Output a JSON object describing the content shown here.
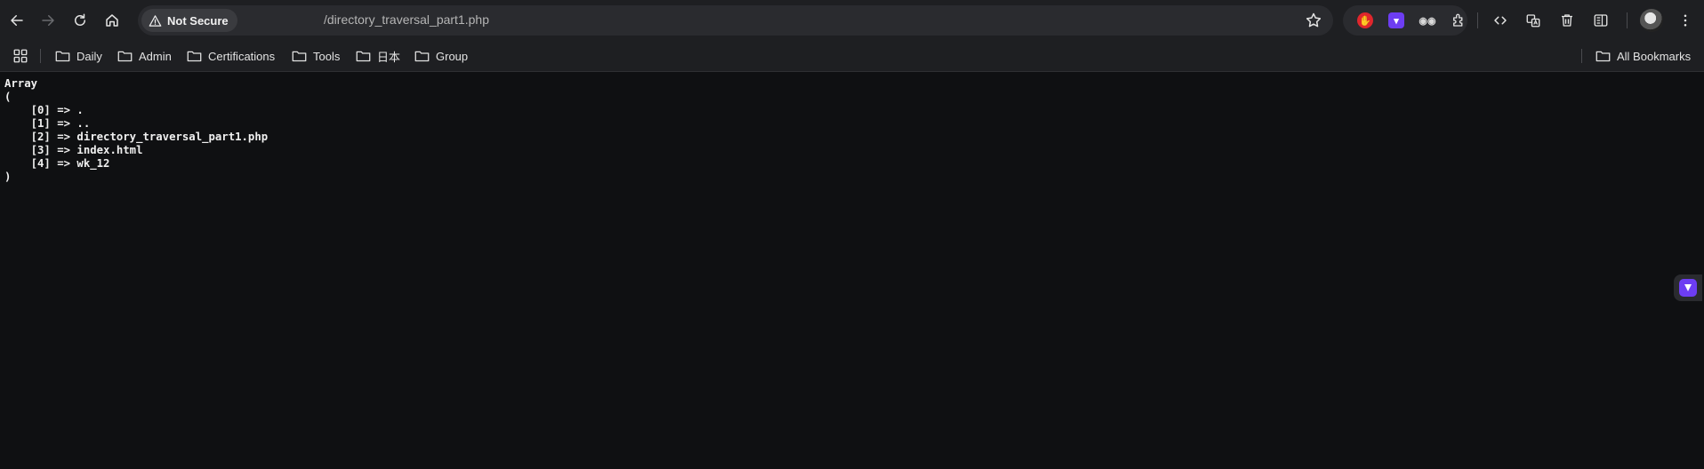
{
  "browser": {
    "security_label": "Not Secure",
    "url": "/directory_traversal_part1.php",
    "icons": {
      "back": "back-arrow-icon",
      "forward": "forward-arrow-icon",
      "reload": "reload-icon",
      "home": "home-icon",
      "bookmark_star": "star-icon"
    },
    "colors": {
      "toolbar": "#1e1f22",
      "page": "#0f1012",
      "extension_purple": "#6d3df2",
      "extension_red": "#e0262c"
    }
  },
  "bookmarks": {
    "items": [
      {
        "label": "Daily"
      },
      {
        "label": "Admin"
      },
      {
        "label": "Certifications"
      },
      {
        "label": "Tools"
      },
      {
        "label": "日本"
      },
      {
        "label": "Group"
      }
    ],
    "all_bookmarks_label": "All Bookmarks"
  },
  "page": {
    "output": "Array\n(\n    [0] => .\n    [1] => ..\n    [2] => directory_traversal_part1.php\n    [3] => index.html\n    [4] => wk_12\n)"
  }
}
